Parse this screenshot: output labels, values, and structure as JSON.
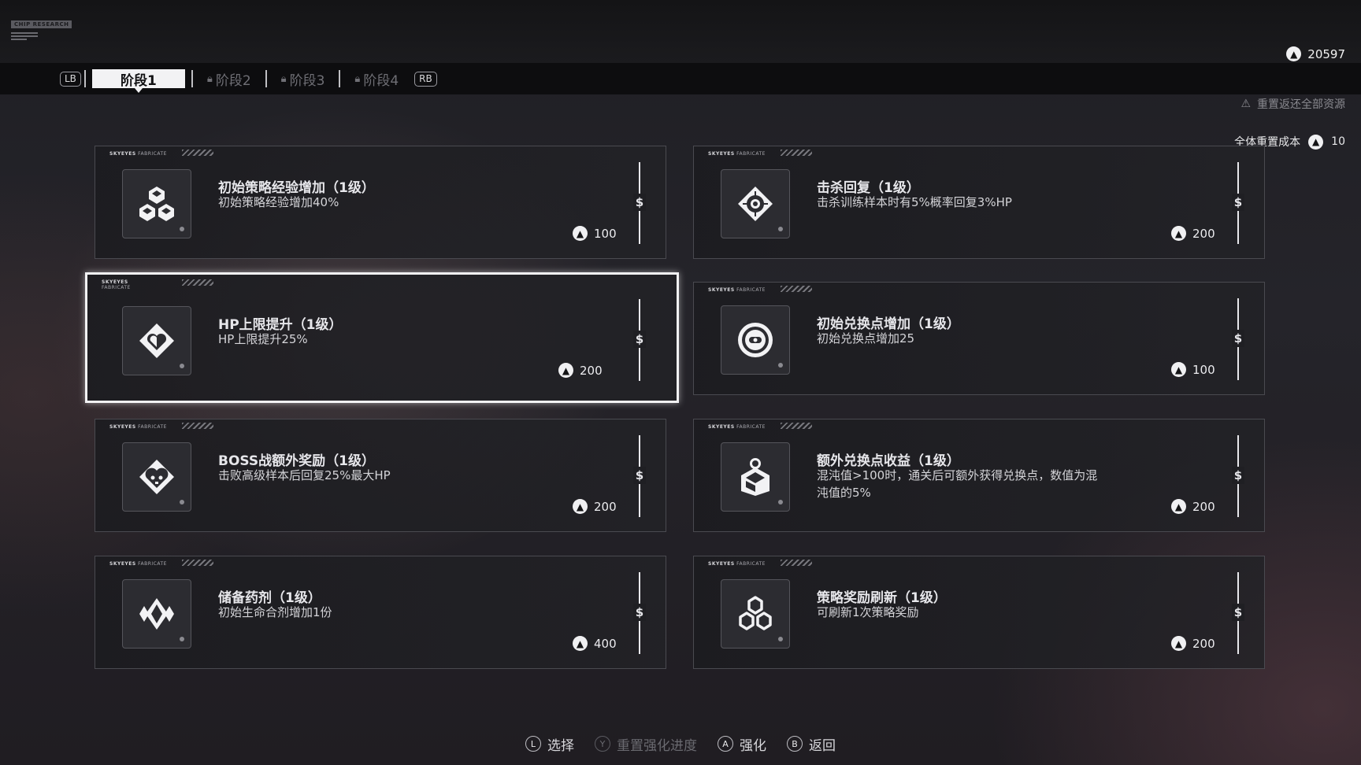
{
  "brand": {
    "tag": "CHIP RESEARCH"
  },
  "currency": {
    "icon": "a-token-icon",
    "amount": "20597"
  },
  "tabs": {
    "lb": "LB",
    "rb": "RB",
    "items": [
      {
        "label": "阶段1",
        "locked": false
      },
      {
        "label": "阶段2",
        "locked": true
      },
      {
        "label": "阶段3",
        "locked": true
      },
      {
        "label": "阶段4",
        "locked": true
      }
    ]
  },
  "reset": {
    "label": "全体重置成本",
    "cost": "10",
    "note": "重置返还全部资源"
  },
  "card_header": {
    "brand": "SKYEYES",
    "sub": "FABRICATE"
  },
  "cards": [
    {
      "title": "初始策略经验增加（1级）",
      "desc": "初始策略经验增加40%",
      "cost": "100",
      "icon": "tri-cubes-icon"
    },
    {
      "title": "击杀回复（1级）",
      "desc": "击杀训练样本时有5%概率回复3%HP",
      "cost": "200",
      "icon": "crosshair-diamond-icon"
    },
    {
      "title": "HP上限提升（1级）",
      "desc": "HP上限提升25%",
      "cost": "200",
      "icon": "heart-diamond-icon"
    },
    {
      "title": "初始兑换点增加（1级）",
      "desc": "初始兑换点增加25",
      "cost": "100",
      "icon": "coin-ring-icon"
    },
    {
      "title": "BOSS战额外奖励（1级）",
      "desc": "击败高级样本后回复25%最大HP",
      "cost": "200",
      "icon": "skull-heart-icon"
    },
    {
      "title": "额外兑换点收益（1级）",
      "desc": "混沌值>100时，通关后可额外获得兑换点，数值为混沌值的5%",
      "cost": "200",
      "icon": "coin-cube-icon"
    },
    {
      "title": "储备药剂（1级）",
      "desc": "初始生命合剂增加1份",
      "cost": "400",
      "icon": "winged-diamond-icon"
    },
    {
      "title": "策略奖励刷新（1级）",
      "desc": "可刷新1次策略奖励",
      "cost": "200",
      "icon": "refresh-cubes-icon"
    }
  ],
  "footer": [
    {
      "key": "L",
      "label": "选择",
      "enabled": true
    },
    {
      "key": "Y",
      "label": "重置强化进度",
      "enabled": false
    },
    {
      "key": "A",
      "label": "强化",
      "enabled": true
    },
    {
      "key": "B",
      "label": "返回",
      "enabled": true
    }
  ]
}
